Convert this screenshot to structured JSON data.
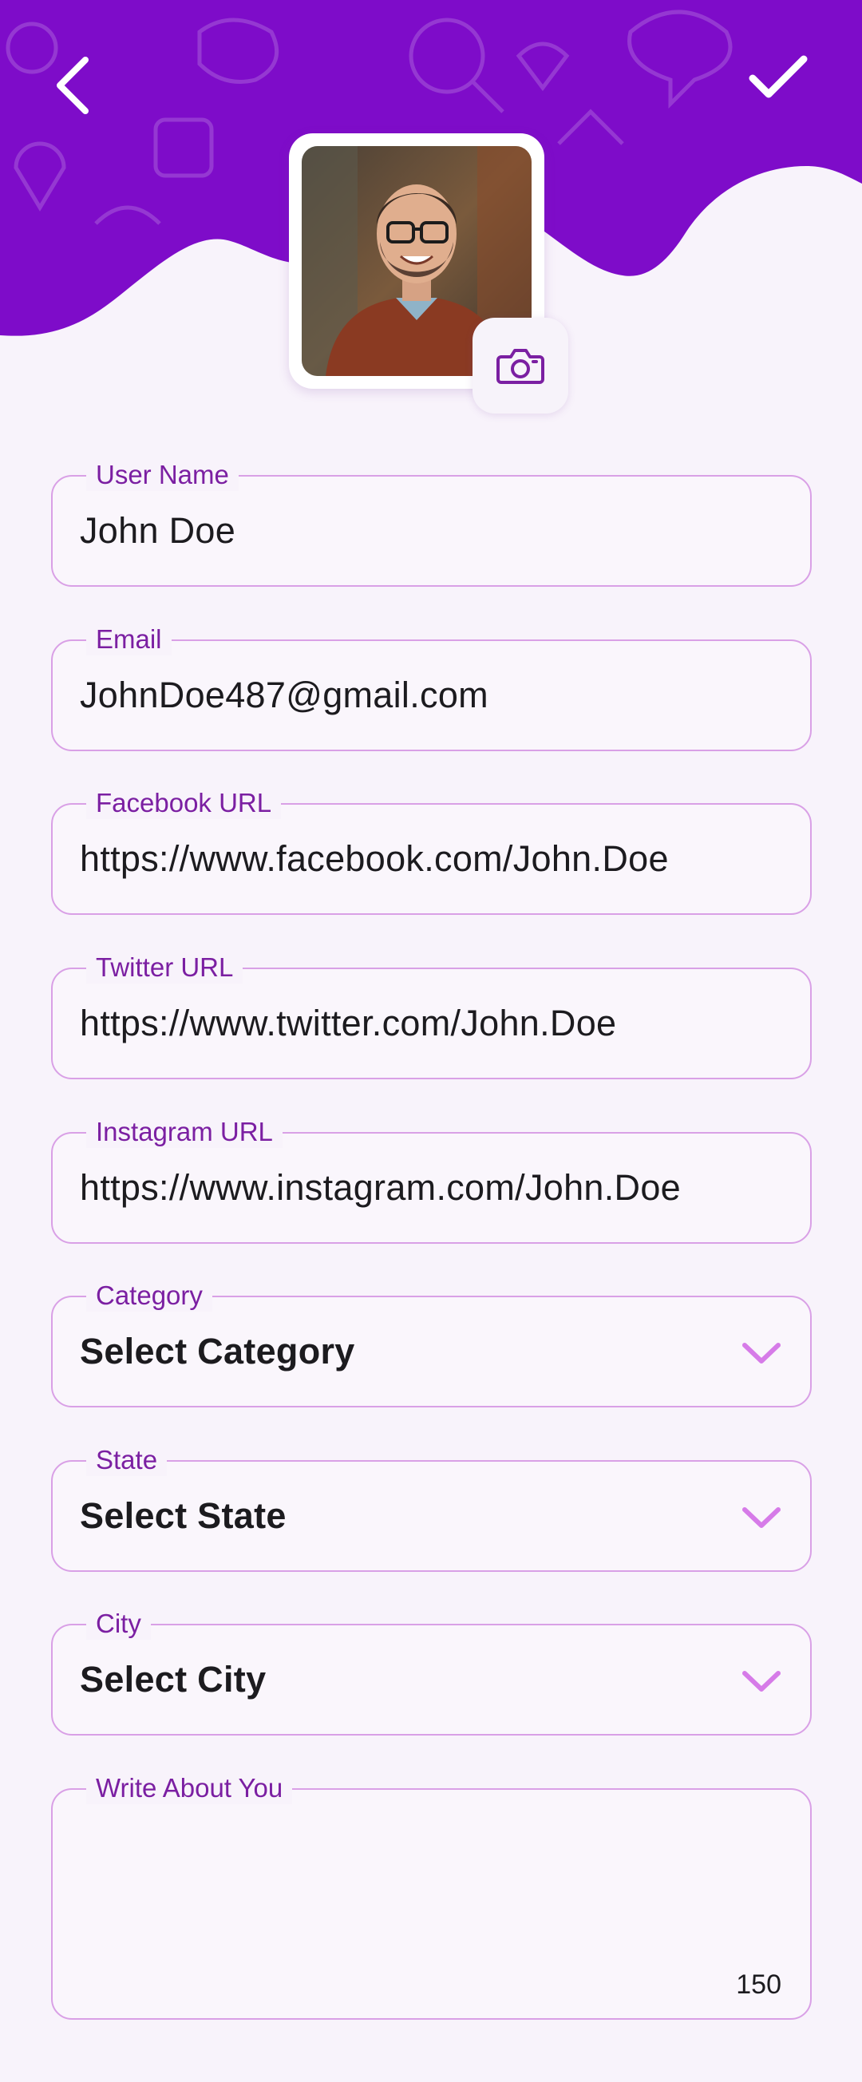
{
  "header": {
    "back_icon": "chevron-left-icon",
    "confirm_icon": "check-icon",
    "background_color": "#7e0cc9",
    "profile_photo_alt": "Profile photo of a smiling man with glasses",
    "camera_icon": "camera-icon"
  },
  "form": {
    "user_name": {
      "label": "User Name",
      "value": "John Doe"
    },
    "email": {
      "label": "Email",
      "value": "JohnDoe487@gmail.com"
    },
    "facebook": {
      "label": "Facebook URL",
      "value": "https://www.facebook.com/John.Doe"
    },
    "twitter": {
      "label": "Twitter URL",
      "value": "https://www.twitter.com/John.Doe"
    },
    "instagram": {
      "label": "Instagram URL",
      "value": "https://www.instagram.com/John.Doe"
    },
    "category": {
      "label": "Category",
      "value": "Select Category"
    },
    "state": {
      "label": "State",
      "value": "Select State"
    },
    "city": {
      "label": "City",
      "value": "Select City"
    },
    "about": {
      "label": "Write About You",
      "value": "",
      "counter": "150"
    }
  },
  "colors": {
    "accent": "#7b1fa2",
    "border": "#d9a0e6",
    "chevron": "#d67be8"
  }
}
